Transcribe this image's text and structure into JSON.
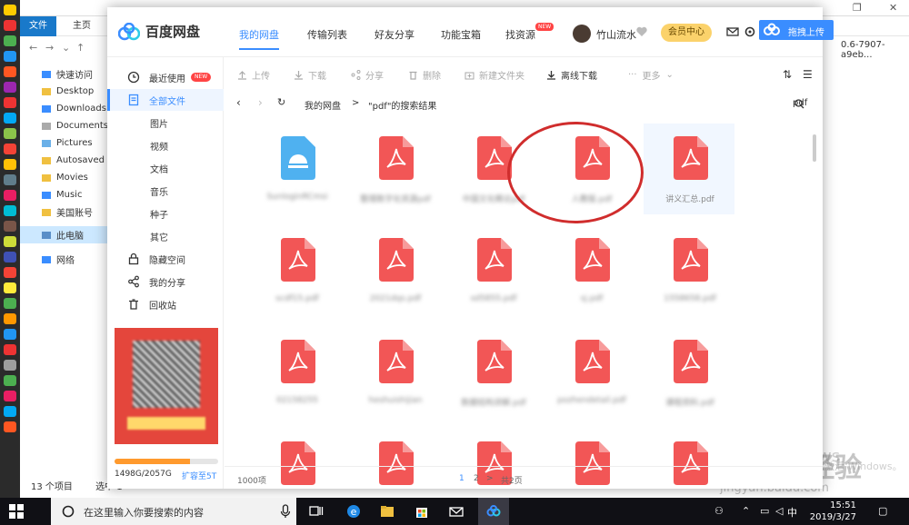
{
  "explorer": {
    "file_tab": "文件",
    "home_tab": "主页",
    "path_fragment": "0.6-7907-a9eb...",
    "tree": [
      {
        "label": "快速访问",
        "icon": "star-icon"
      },
      {
        "label": "Desktop",
        "icon": "folder-icon"
      },
      {
        "label": "Downloads",
        "icon": "download-icon"
      },
      {
        "label": "Documents",
        "icon": "document-icon"
      },
      {
        "label": "Pictures",
        "icon": "picture-icon"
      },
      {
        "label": "Autosaved C",
        "icon": "folder-icon"
      },
      {
        "label": "Movies",
        "icon": "folder-icon"
      },
      {
        "label": "Music",
        "icon": "music-icon"
      },
      {
        "label": "美国账号",
        "icon": "folder-icon"
      },
      {
        "label": "此电脑",
        "icon": "computer-icon"
      },
      {
        "label": "网络",
        "icon": "network-icon"
      }
    ],
    "status_count": "13 个项目",
    "status_selected": "选中 1"
  },
  "netdisk": {
    "logo_text": "百度网盘",
    "nav_tabs": [
      "我的网盘",
      "传输列表",
      "好友分享",
      "功能宝箱",
      "找资源"
    ],
    "nav_new_badge": "NEW",
    "username": "竹山流水",
    "vip_button": "会员中心",
    "upload_drag_button": "拖拽上传",
    "sidebar": {
      "recent": "最近使用",
      "recent_badge": "NEW",
      "all_files": "全部文件",
      "categories": [
        "图片",
        "视频",
        "文档",
        "音乐",
        "种子",
        "其它"
      ],
      "private": "隐藏空间",
      "my_share": "我的分享",
      "recycle": "回收站"
    },
    "quota": {
      "text": "1498G/2057G",
      "used_fraction": 0.728,
      "expand_link": "扩容至5T"
    },
    "toolbar": {
      "upload": "上传",
      "download": "下载",
      "share": "分享",
      "delete": "删除",
      "new_folder": "新建文件夹",
      "offline_download": "离线下载",
      "more": "更多"
    },
    "breadcrumb": {
      "root": "我的网盘",
      "separator": ">",
      "current": "\"pdf\"的搜索结果"
    },
    "search_value": "pdf",
    "file_rows": [
      [
        {
          "type": "disk",
          "name": "SunloginRCmsi"
        },
        {
          "type": "pdf",
          "name": "整理数字化资源pdf"
        },
        {
          "type": "pdf",
          "name": "中国文化概论pdf"
        },
        {
          "type": "pdf",
          "name": "人教版.pdf"
        },
        {
          "type": "pdf",
          "name": "讲义汇总.pdf"
        }
      ],
      [
        {
          "type": "pdf",
          "name": "scdf15.pdf"
        },
        {
          "type": "pdf",
          "name": "2021dqs.pdf"
        },
        {
          "type": "pdf",
          "name": "sd5855.pdf"
        },
        {
          "type": "pdf",
          "name": "sj.pdf"
        },
        {
          "type": "pdf",
          "name": "1558658.pdf"
        }
      ],
      [
        {
          "type": "pdf",
          "name": "02158255"
        },
        {
          "type": "pdf",
          "name": "heshuishijian"
        },
        {
          "type": "pdf",
          "name": "数据结构讲解.pdf"
        },
        {
          "type": "pdf",
          "name": "pozhendetail.pdf"
        },
        {
          "type": "pdf",
          "name": "课程资料.pdf"
        }
      ],
      [
        {
          "type": "pdf",
          "name": ""
        },
        {
          "type": "pdf",
          "name": ""
        },
        {
          "type": "pdf",
          "name": ""
        },
        {
          "type": "pdf",
          "name": ""
        },
        {
          "type": "pdf",
          "name": ""
        }
      ]
    ],
    "footer": {
      "count": "1000项",
      "page1": "1",
      "page2": "2",
      "next": ">",
      "total": "共2页"
    }
  },
  "watermark": {
    "line1": "激活 Windows",
    "line2": "转到设置以激活 Windows。",
    "baidu": "Baidu经验",
    "baidu_url": "jingyan.baidu.com"
  },
  "taskbar": {
    "search_placeholder": "在这里输入你要搜索的内容",
    "time": "15:51",
    "date": "2019/3/27",
    "ime": "中"
  },
  "colors": {
    "accent": "#3a8dff",
    "pdf_red": "#f25656",
    "annotation_circle": "#d02d2d"
  }
}
